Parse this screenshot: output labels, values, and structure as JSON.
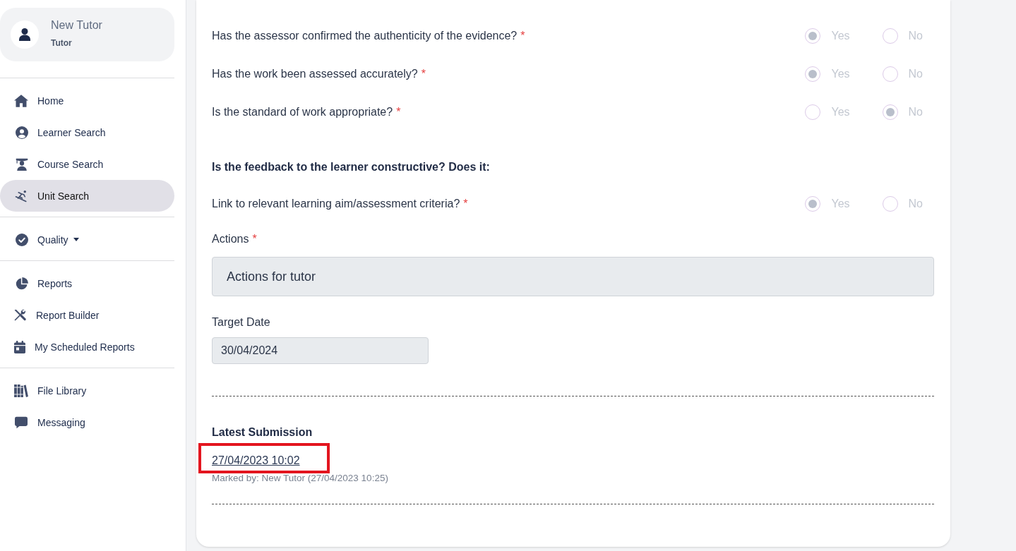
{
  "sidebar": {
    "profile": {
      "name": "New Tutor",
      "role": "Tutor"
    },
    "sections": [
      {
        "items": [
          {
            "label": "Home",
            "kind": "link",
            "selected": false
          },
          {
            "label": "Learner Search",
            "kind": "link",
            "selected": false
          },
          {
            "label": "Course Search",
            "kind": "link",
            "selected": false
          },
          {
            "label": "Unit Search",
            "kind": "link",
            "selected": true
          }
        ]
      },
      {
        "items": [
          {
            "label": "Quality",
            "kind": "dropdown",
            "selected": false
          }
        ]
      },
      {
        "items": [
          {
            "label": "Reports",
            "kind": "link",
            "selected": false
          },
          {
            "label": "Report Builder",
            "kind": "link",
            "selected": false
          },
          {
            "label": "My Scheduled Reports",
            "kind": "link",
            "selected": false
          }
        ]
      },
      {
        "items": [
          {
            "label": "File Library",
            "kind": "link",
            "selected": false
          },
          {
            "label": "Messaging",
            "kind": "link",
            "selected": false
          }
        ]
      }
    ]
  },
  "form": {
    "items": [
      {
        "kind": "radio",
        "label": "Has the assessor confirmed the authenticity of the evidence?",
        "required_mark": "*",
        "disabled": true,
        "options": [
          {
            "label": "Yes",
            "selected": true
          },
          {
            "label": "No",
            "selected": false
          }
        ]
      },
      {
        "kind": "radio",
        "label": "Has the work been assessed accurately?",
        "required_mark": "*",
        "disabled": true,
        "options": [
          {
            "label": "Yes",
            "selected": true
          },
          {
            "label": "No",
            "selected": false
          }
        ]
      },
      {
        "kind": "radio",
        "label": "Is the standard of work appropriate?",
        "required_mark": "*",
        "disabled": true,
        "options": [
          {
            "label": "Yes",
            "selected": false
          },
          {
            "label": "No",
            "selected": true
          }
        ]
      },
      {
        "kind": "heading",
        "label": "Is the feedback to the learner constructive? Does it:"
      },
      {
        "kind": "radio",
        "label": "Link to relevant learning aim/assessment criteria?",
        "required_mark": "*",
        "disabled": true,
        "options": [
          {
            "label": "Yes",
            "selected": true
          },
          {
            "label": "No",
            "selected": false
          }
        ]
      },
      {
        "kind": "textarea",
        "label": "Actions",
        "required_mark": "*",
        "disabled": true,
        "value": "Actions for tutor"
      },
      {
        "kind": "date",
        "label": "Target Date",
        "disabled": true,
        "value": "30/04/2024"
      }
    ]
  },
  "latest_submission": {
    "heading": "Latest Submission",
    "link": "27/04/2023 10:02",
    "highlighted": true,
    "marked_by": "Marked by: New Tutor (27/04/2023 10:25)"
  }
}
